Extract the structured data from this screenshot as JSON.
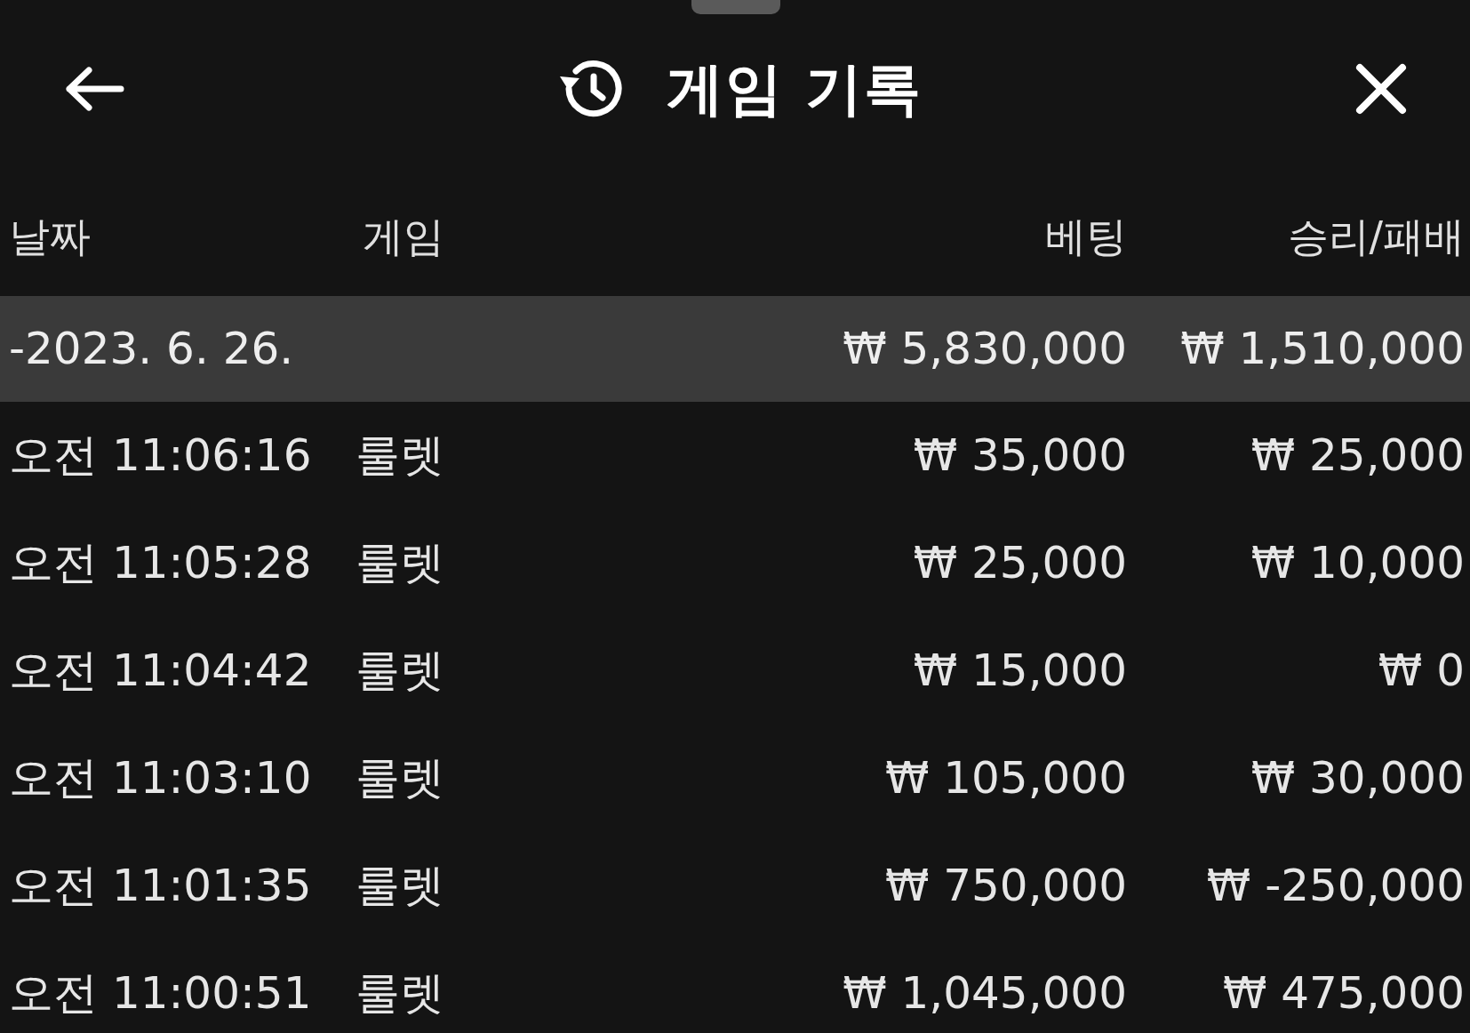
{
  "header": {
    "title": "게임 기록"
  },
  "table": {
    "columns": [
      "날짜",
      "게임",
      "베팅",
      "승리/패배"
    ],
    "summary": {
      "date": "-2023. 6. 26.",
      "bet": "₩ 5,830,000",
      "result": "₩ 1,510,000"
    },
    "rows": [
      {
        "time": "오전 11:06:16",
        "game": "룰렛",
        "bet": "₩ 35,000",
        "result": "₩ 25,000"
      },
      {
        "time": "오전 11:05:28",
        "game": "룰렛",
        "bet": "₩ 25,000",
        "result": "₩ 10,000"
      },
      {
        "time": "오전 11:04:42",
        "game": "룰렛",
        "bet": "₩ 15,000",
        "result": "₩ 0"
      },
      {
        "time": "오전 11:03:10",
        "game": "룰렛",
        "bet": "₩ 105,000",
        "result": "₩ 30,000"
      },
      {
        "time": "오전 11:01:35",
        "game": "룰렛",
        "bet": "₩ 750,000",
        "result": "₩ -250,000"
      },
      {
        "time": "오전 11:00:51",
        "game": "룰렛",
        "bet": "₩ 1,045,000",
        "result": "₩ 475,000"
      }
    ]
  }
}
